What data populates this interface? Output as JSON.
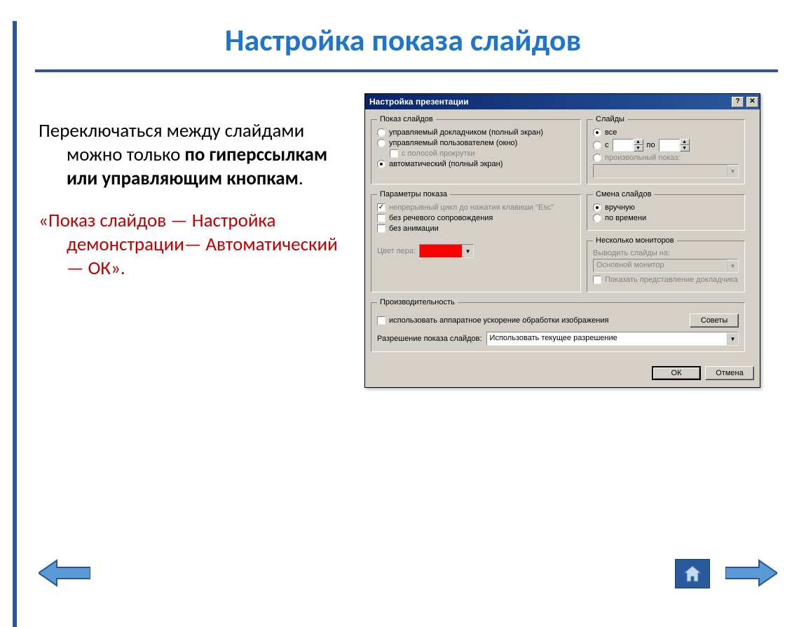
{
  "slide": {
    "title": "Настройка показа слайдов",
    "text1_part1": "Переключаться между слайдами можно только ",
    "text1_bold": "по гиперссылкам или управляющим кнопкам",
    "text1_part2": ".",
    "text2": "«Показ слайдов — Настройка демонстрации— Автоматический — ОК»."
  },
  "dialog": {
    "title": "Настройка презентации",
    "group_show": {
      "legend": "Показ слайдов",
      "opt1": "управляемый докладчиком (полный экран)",
      "opt2": "управляемый пользователем (окно)",
      "opt2_sub": "с полосой прокрутки",
      "opt3": "автоматический (полный экран)"
    },
    "group_slides": {
      "legend": "Слайды",
      "opt_all": "все",
      "opt_from": "с",
      "opt_to": "по",
      "opt_custom": "произвольный показ:"
    },
    "group_params": {
      "legend": "Параметры показа",
      "chk_loop": "непрерывный цикл до нажатия клавиши \"Esc\"",
      "chk_nospeech": "без речевого сопровождения",
      "chk_noanim": "без анимации",
      "pen_label": "Цвет пера:",
      "pen_color": "#ff0000"
    },
    "group_advance": {
      "legend": "Смена слайдов",
      "opt_manual": "вручную",
      "opt_timings": "по времени"
    },
    "group_monitors": {
      "legend": "Несколько мониторов",
      "label_out": "Выводить слайды на:",
      "dd_value": "Основной монитор",
      "chk_presenter": "Показать представление докладчика"
    },
    "group_perf": {
      "legend": "Производительность",
      "chk_hw": "использовать аппаратное ускорение обработки изображения",
      "btn_tips": "Советы",
      "res_label": "Разрешение показа слайдов:",
      "res_value": "Использовать текущее разрешение"
    },
    "buttons": {
      "ok": "ОК",
      "cancel": "Отмена"
    }
  }
}
